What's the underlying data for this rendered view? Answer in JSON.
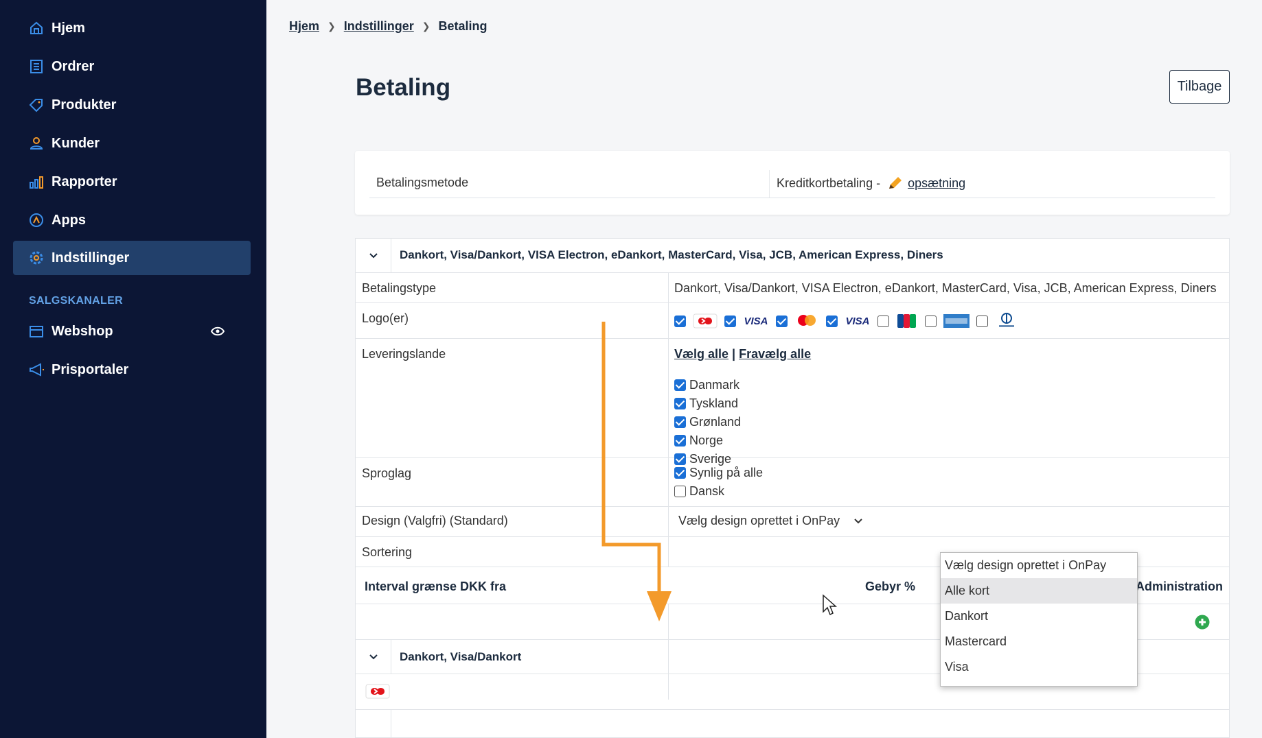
{
  "sidebar": {
    "items": [
      {
        "label": "Hjem",
        "icon": "home-icon"
      },
      {
        "label": "Ordrer",
        "icon": "orders-icon"
      },
      {
        "label": "Produkter",
        "icon": "tag-icon"
      },
      {
        "label": "Kunder",
        "icon": "user-icon"
      },
      {
        "label": "Rapporter",
        "icon": "bar-chart-icon"
      },
      {
        "label": "Apps",
        "icon": "apps-icon"
      },
      {
        "label": "Indstillinger",
        "icon": "gear-icon",
        "active": true
      }
    ],
    "section_label": "SALGSKANALER",
    "channels": [
      {
        "label": "Webshop",
        "icon": "shop-icon"
      },
      {
        "label": "Prisportaler",
        "icon": "megaphone-icon"
      }
    ]
  },
  "breadcrumb": [
    "Hjem",
    "Indstillinger",
    "Betaling"
  ],
  "page_title": "Betaling",
  "back_button": "Tilbage",
  "method_card": {
    "label": "Betalingsmetode",
    "value": "Kreditkortbetaling -",
    "link": "opsætning"
  },
  "group1": {
    "title": "Dankort, Visa/Dankort, VISA Electron, eDankort, MasterCard, Visa, JCB, American Express, Diners",
    "betalingstype_label": "Betalingstype",
    "betalingstype_value": "Dankort, Visa/Dankort, VISA Electron, eDankort, MasterCard, Visa, JCB, American Express, Diners",
    "logo_label": "Logo(er)",
    "logos": [
      {
        "name": "dankort",
        "checked": true
      },
      {
        "name": "visa-electron",
        "checked": true
      },
      {
        "name": "mastercard",
        "checked": true
      },
      {
        "name": "visa",
        "checked": true
      },
      {
        "name": "jcb",
        "checked": false
      },
      {
        "name": "american-express",
        "checked": false
      },
      {
        "name": "diners",
        "checked": false
      }
    ],
    "leveringslande_label": "Leveringslande",
    "select_all": "Vælg alle",
    "separator": "|",
    "deselect_all": "Fravælg alle",
    "countries": [
      {
        "name": "Danmark",
        "checked": true
      },
      {
        "name": "Tyskland",
        "checked": true
      },
      {
        "name": "Grønland",
        "checked": true
      },
      {
        "name": "Norge",
        "checked": true
      },
      {
        "name": "Sverige",
        "checked": true
      }
    ],
    "sproglag_label": "Sproglag",
    "languages": [
      {
        "name": "Synlig på alle",
        "checked": true
      },
      {
        "name": "Dansk",
        "checked": false
      }
    ],
    "design_label": "Design (Valgfri) (Standard)",
    "design_value": "Vælg design oprettet i OnPay",
    "sortering_label": "Sortering",
    "col_interval": "Interval grænse DKK fra",
    "col_gebyr": "Gebyr %",
    "col_admin": "Administration"
  },
  "group2": {
    "title": "Dankort, Visa/Dankort"
  },
  "dropdown_options": [
    "Vælg design oprettet i OnPay",
    "Alle kort",
    "Dankort",
    "Mastercard",
    "Visa"
  ],
  "dropdown_hover_index": 1,
  "colors": {
    "sidebar_bg": "#0c1635",
    "active_bg": "#22406b",
    "accent": "#1a6fd6",
    "section_label": "#63a2e6",
    "arrow": "#f39a2b",
    "add_green": "#2fa84f"
  }
}
